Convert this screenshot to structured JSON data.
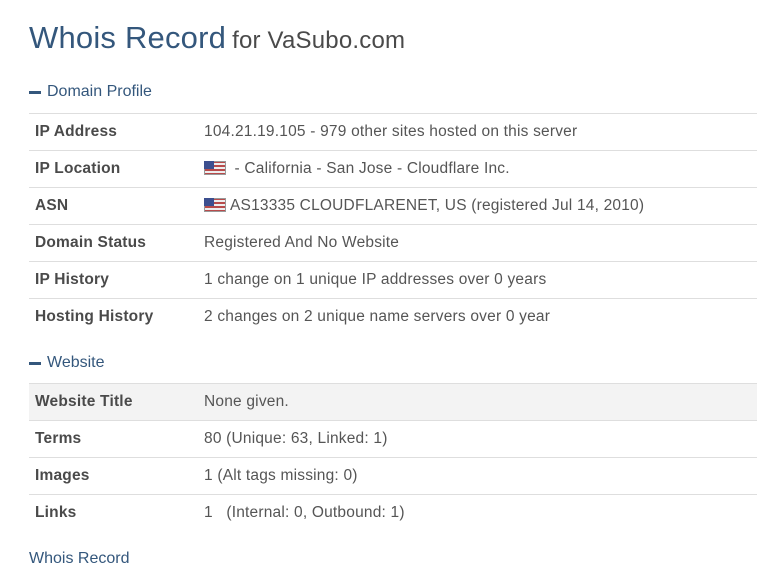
{
  "header": {
    "title": "Whois Record",
    "subtitle": "for VaSubo.com"
  },
  "domain_profile": {
    "heading": "Domain Profile",
    "rows": [
      {
        "label": "IP Address",
        "value": "104.21.19.105 - 979 other sites hosted on this server"
      },
      {
        "label": "IP Location",
        "value": " - California - San Jose - Cloudflare Inc.",
        "icon": "us-flag-icon"
      },
      {
        "label": "ASN",
        "value": "AS13335 CLOUDFLARENET, US (registered Jul 14, 2010)",
        "icon": "us-flag-icon"
      },
      {
        "label": "Domain Status",
        "value": "Registered And No Website"
      },
      {
        "label": "IP History",
        "value": "1 change on 1 unique IP addresses over 0 years"
      },
      {
        "label": "Hosting History",
        "value": "2 changes on 2 unique name servers over 0 year"
      }
    ]
  },
  "website": {
    "heading": "Website",
    "rows": [
      {
        "label": "Website Title",
        "value": "None given."
      },
      {
        "label": "Terms",
        "value": "80 (Unique: 63, Linked: 1)"
      },
      {
        "label": "Images",
        "value": "1 (Alt tags missing: 0)"
      },
      {
        "label": "Links",
        "value": "1   (Internal: 0, Outbound: 1)"
      }
    ]
  },
  "footer": {
    "whois_record_link": "Whois Record"
  },
  "colors": {
    "accent": "#34577c",
    "row_border": "#dedede",
    "shaded_row": "#f3f3f3"
  }
}
